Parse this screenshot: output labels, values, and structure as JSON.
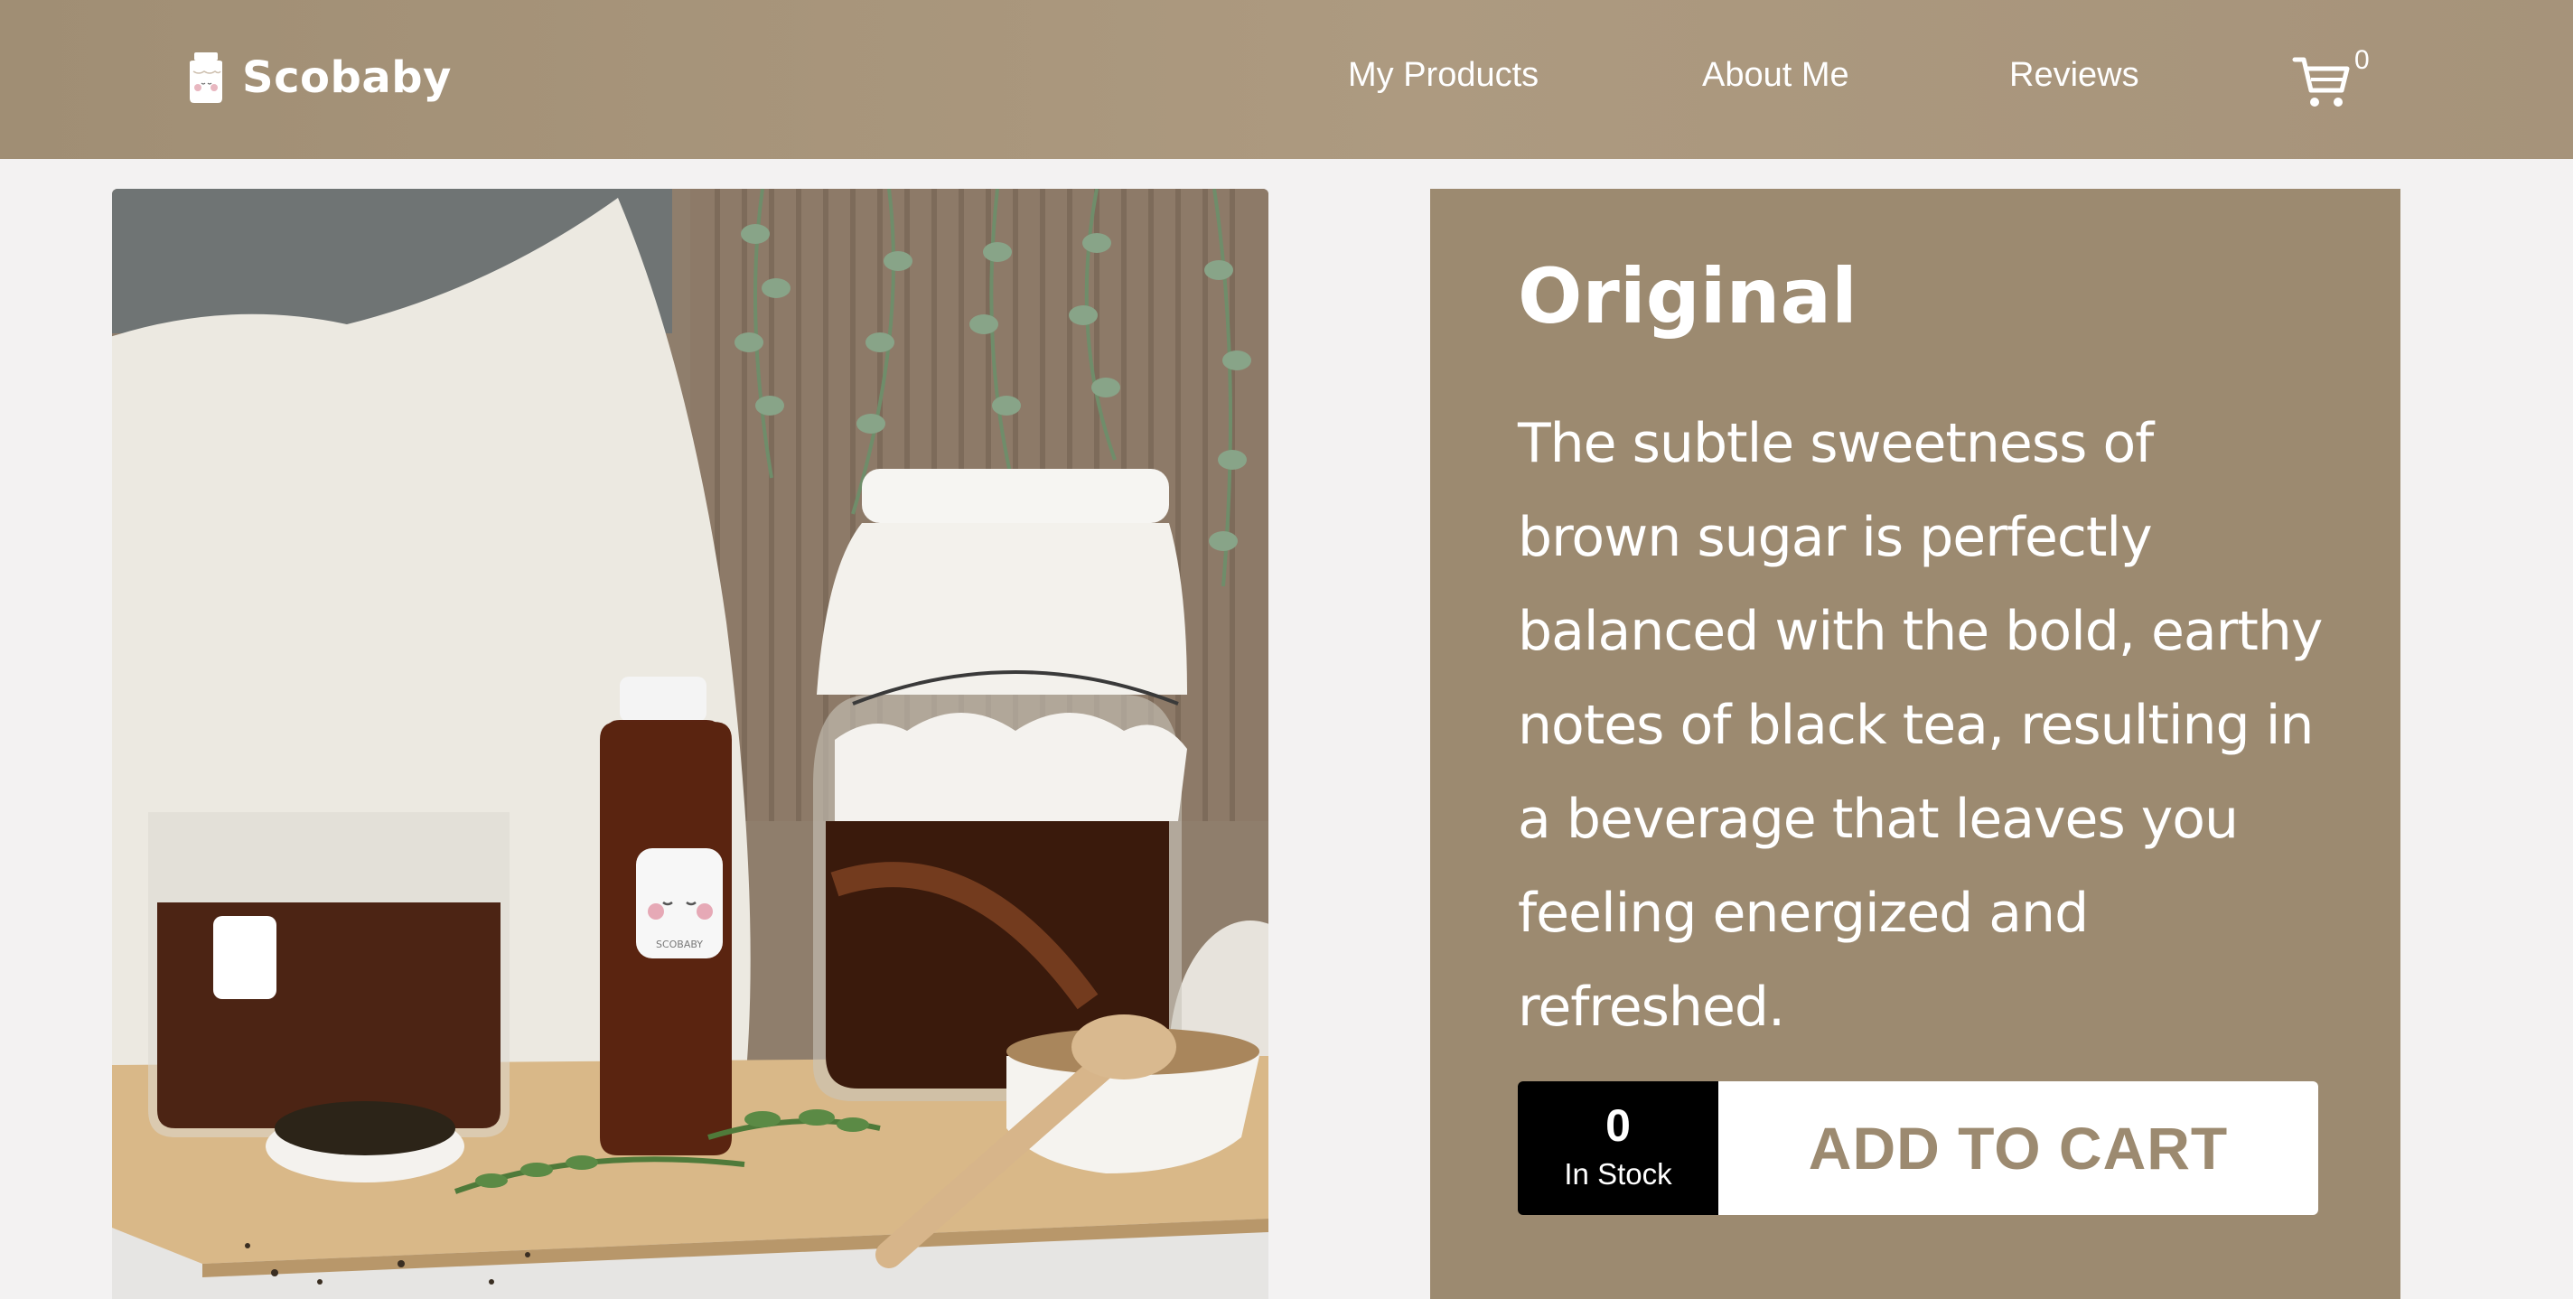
{
  "nav": {
    "brand": "Scobaby",
    "links": [
      "My Products",
      "About Me",
      "Reviews"
    ],
    "cart_count": "0"
  },
  "product": {
    "title": "Original",
    "description": "The subtle sweetness of brown sugar is perfectly balanced with the bold, earthy notes of black tea, resulting in a beverage that leaves you feeling energized and refreshed.",
    "stock_count": "0",
    "stock_label": "In Stock",
    "add_to_cart": "ADD TO CART",
    "image": {
      "bottle_label": "SCOBABY"
    }
  },
  "colors": {
    "nav_bg": "#a99679",
    "panel_bg": "#9c8a70",
    "page_bg": "#f3f2f2",
    "button_text": "#9c8a70"
  }
}
